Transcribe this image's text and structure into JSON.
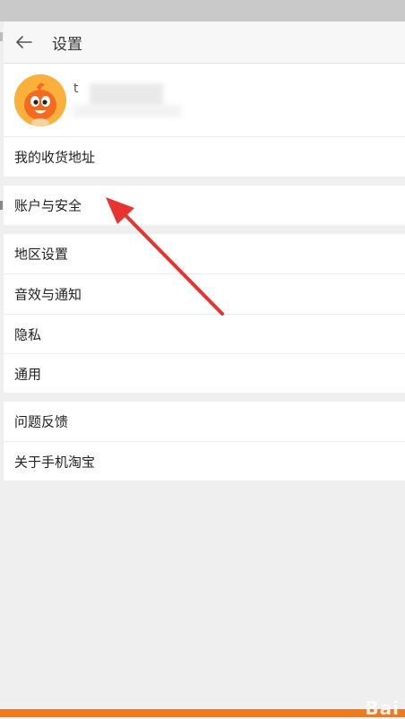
{
  "header": {
    "title": "设置",
    "back_icon": "back-arrow-icon"
  },
  "profile": {
    "username_visible": "t",
    "avatar_icon": "taobao-mascot-avatar"
  },
  "menu": {
    "address": "我的收货地址",
    "account_security": "账户与安全",
    "region": "地区设置",
    "sound_notify": "音效与通知",
    "privacy": "隐私",
    "general": "通用",
    "feedback": "问题反馈",
    "about": "关于手机淘宝"
  },
  "watermark": "Bai",
  "colors": {
    "accent": "#f07a1a",
    "annotation_arrow": "#e8332e",
    "page_background": "#efefef"
  }
}
